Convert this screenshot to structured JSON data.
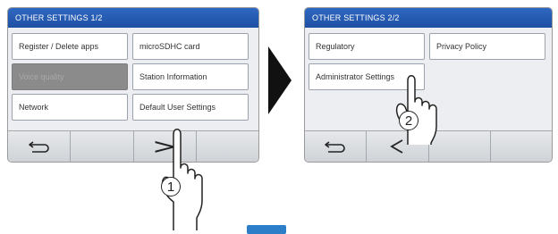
{
  "screen1": {
    "title": "OTHER SETTINGS 1/2",
    "buttons": {
      "register_delete_apps": "Register / Delete apps",
      "microsdhc_card": "microSDHC card",
      "voice_quality": "Voice quality",
      "station_information": "Station Information",
      "network": "Network",
      "default_user_settings": "Default User Settings"
    },
    "toolbar": {
      "back_icon": "back-arrow-icon",
      "next_icon": "chevron-right-icon",
      "next_glyph": ">"
    },
    "step_number": "1"
  },
  "screen2": {
    "title": "OTHER SETTINGS 2/2",
    "buttons": {
      "regulatory": "Regulatory",
      "privacy_policy": "Privacy Policy",
      "administrator_settings": "Administrator Settings"
    },
    "toolbar": {
      "back_icon": "back-arrow-icon",
      "prev_icon": "chevron-left-icon"
    },
    "step_number": "2"
  },
  "colors": {
    "title_bar": "#1e4fa3",
    "screen_bg": "#eceef1",
    "disabled_button": "#8b8b8b",
    "arrow": "#111111",
    "accent_tab": "#2c7ec8"
  }
}
